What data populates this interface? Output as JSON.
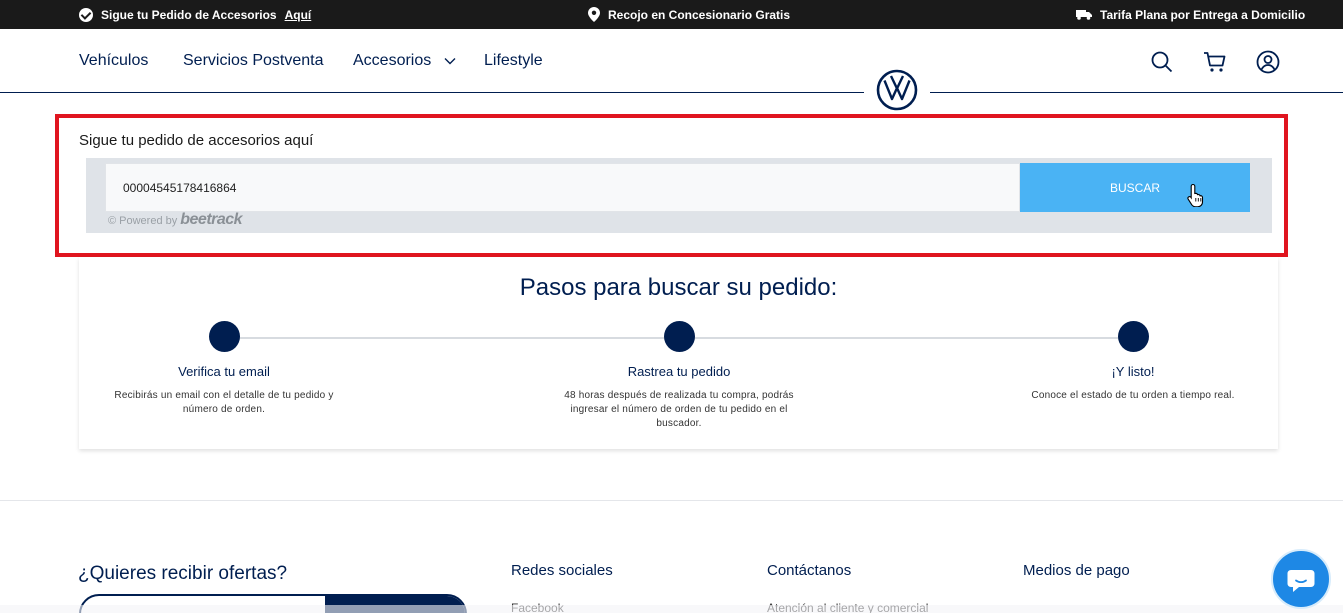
{
  "topbar": {
    "item1_text": "Sigue tu Pedido de Accesorios",
    "item1_link": "Aquí",
    "item2_text": "Recojo en Concesionario Gratis",
    "item3_text": "Tarifa Plana por Entrega a Domicilio"
  },
  "nav": {
    "items": [
      {
        "label": "Vehículos"
      },
      {
        "label": "Servicios Postventa"
      },
      {
        "label": "Accesorios"
      },
      {
        "label": "Lifestyle"
      }
    ]
  },
  "tracking": {
    "title": "Sigue tu pedido de accesorios aquí",
    "input_value": "00004545178416864",
    "button_label": "BUSCAR",
    "powered_prefix": "© Powered by",
    "powered_brand": "beetrack"
  },
  "steps": {
    "heading": "Pasos para buscar su pedido:",
    "items": [
      {
        "title": "Verifica tu email",
        "desc": "Recibirás un email con el detalle de tu pedido y número de orden."
      },
      {
        "title": "Rastrea tu pedido",
        "desc": "48 horas después de realizada tu compra, podrás ingresar el número de orden de tu pedido en el buscador."
      },
      {
        "title": "¡Y listo!",
        "desc": "Conoce el estado de tu orden a tiempo real."
      }
    ]
  },
  "footer": {
    "offers_title": "¿Quieres recibir ofertas?",
    "col1": "Redes sociales",
    "col1_sub": "Facebook",
    "col2": "Contáctanos",
    "col2_sub": "Atención al cliente y comercial",
    "col3": "Medios de pago"
  },
  "colors": {
    "brand_navy": "#001e50",
    "button_blue": "#4ab3f4",
    "highlight_red": "#e0151f",
    "topbar_bg": "#1a1a1a",
    "chat_blue": "#1e88e5"
  },
  "icons": [
    "check-circle-icon",
    "location-pin-icon",
    "truck-icon",
    "chevron-down-icon",
    "vw-logo",
    "search-icon",
    "cart-icon",
    "user-icon",
    "hand-cursor-icon",
    "chat-bubble-icon"
  ]
}
